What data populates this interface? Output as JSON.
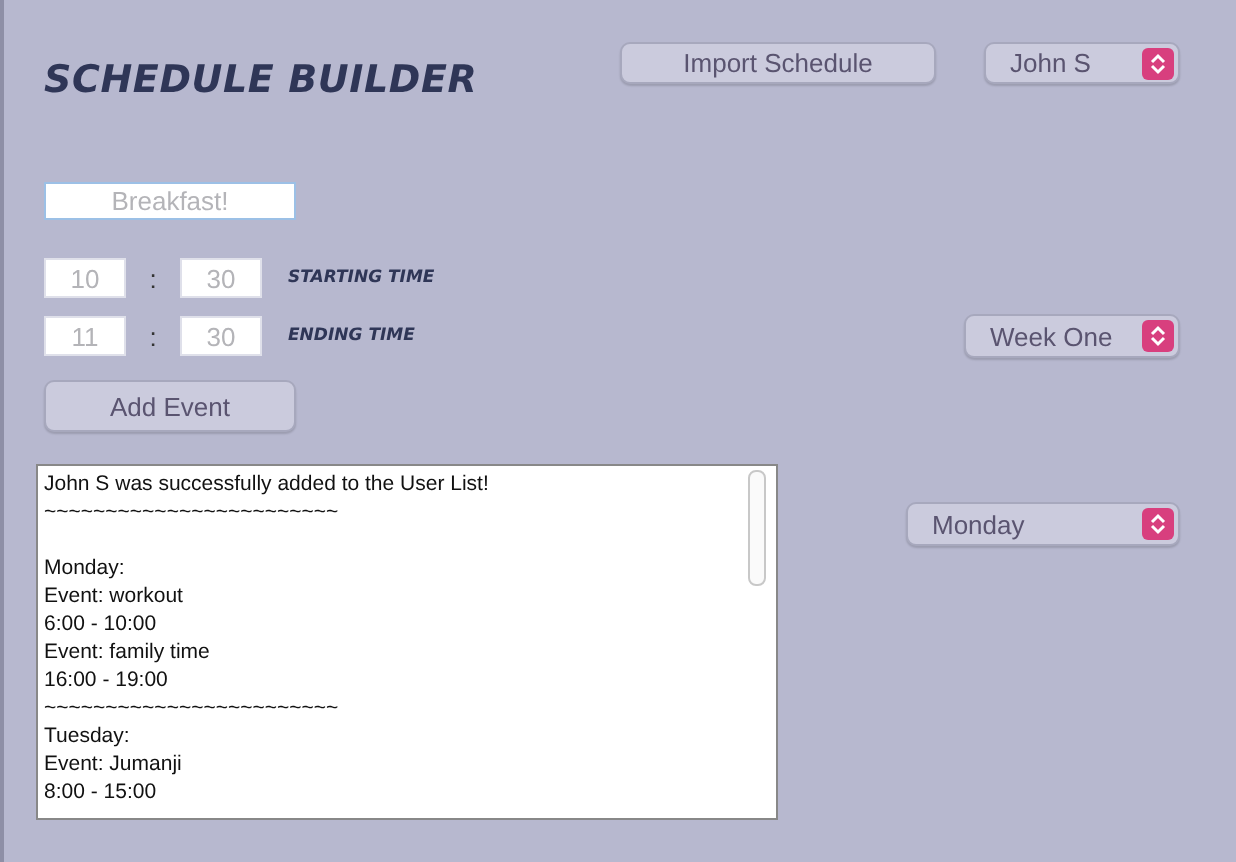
{
  "title": "SCHEDULE BUILDER",
  "import_button": "Import Schedule",
  "user_select": {
    "value": "John S"
  },
  "event_field": {
    "placeholder": "Breakfast!"
  },
  "time_rows": [
    {
      "hour": {
        "placeholder": "10"
      },
      "separator": ":",
      "minute": {
        "placeholder": "30"
      },
      "label": "STARTING TIME"
    },
    {
      "hour": {
        "placeholder": "11"
      },
      "separator": ":",
      "minute": {
        "placeholder": "30"
      },
      "label": "ENDING TIME"
    }
  ],
  "week_select": {
    "value": "Week One"
  },
  "add_button": "Add Event",
  "day_select": {
    "value": "Monday"
  },
  "log": [
    "John S was successfully added to the User List!",
    {
      "text": "~~~~~~~~~~~~~~~~~~~~~~~~",
      "gap_after": true
    },
    "Monday:",
    "Event: workout",
    "6:00 - 10:00",
    "Event: family time",
    "16:00 - 19:00",
    "~~~~~~~~~~~~~~~~~~~~~~~~",
    "Tuesday:",
    "Event: Jumanji",
    "8:00 - 15:00"
  ]
}
